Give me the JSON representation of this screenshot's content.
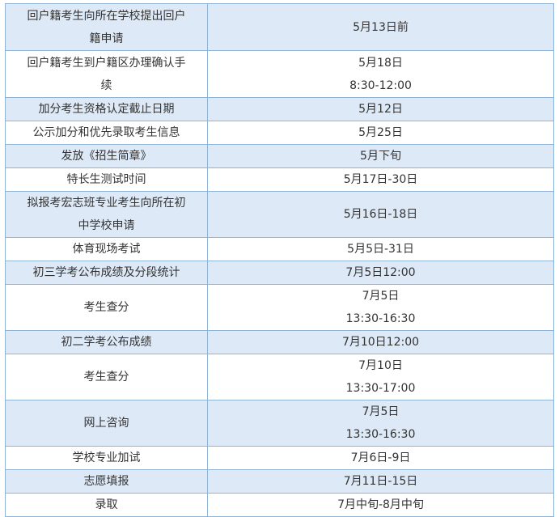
{
  "rows": [
    {
      "item": "回户籍考生向所在学校提出回户\n籍申请",
      "date": "5月13日前",
      "h": 58
    },
    {
      "item": "回户籍考生到户籍区办理确认手\n续",
      "date": "5月18日\n8:30-12:00",
      "h": 58
    },
    {
      "item": "加分考生资格认定截止日期",
      "date": "5月12日",
      "h": 29
    },
    {
      "item": "公示加分和优先录取考生信息",
      "date": "5月25日",
      "h": 29
    },
    {
      "item": "发放《招生简章》",
      "date": "5月下旬",
      "h": 29
    },
    {
      "item": "特长生测试时间",
      "date": "5月17日-30日",
      "h": 29
    },
    {
      "item": "拟报考宏志班专业考生向所在初\n中学校申请",
      "date": "5月16日-18日",
      "h": 57
    },
    {
      "item": "体育现场考试",
      "date": "5月5日-31日",
      "h": 29
    },
    {
      "item": "初三学考公布成绩及分段统计",
      "date": "7月5日12:00",
      "h": 29
    },
    {
      "item": "考生查分",
      "date": "7月5日\n13:30-16:30",
      "h": 57
    },
    {
      "item": "初二学考公布成绩",
      "date": "7月10日12:00",
      "h": 29
    },
    {
      "item": "考生查分",
      "date": "7月10日\n13:30-17:00",
      "h": 57
    },
    {
      "item": "网上咨询",
      "date": "7月5日\n13:30-16:30",
      "h": 57
    },
    {
      "item": "学校专业加试",
      "date": "7月6日-9日",
      "h": 29
    },
    {
      "item": "志愿填报",
      "date": "7月11日-15日",
      "h": 29
    },
    {
      "item": "录取",
      "date": "7月中旬-8月中旬",
      "h": 29
    }
  ]
}
